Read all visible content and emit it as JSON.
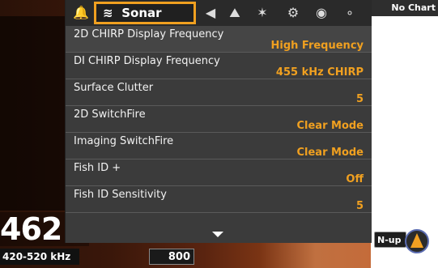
{
  "sonar": {
    "depth": "462",
    "frequency_label": "420-520 kHz",
    "scale_bottom": "800"
  },
  "chart": {
    "no_chart_label": "No Chart",
    "orientation_label": "N-up"
  },
  "menu": {
    "tabs": [
      {
        "icon": "alarm-icon",
        "glyph": "🔔"
      },
      {
        "icon": "sonar-icon",
        "glyph": "≋",
        "label": "Sonar",
        "active": true
      },
      {
        "icon": "navigation-icon",
        "glyph": "◀"
      },
      {
        "icon": "chart-icon",
        "glyph": "⛰"
      },
      {
        "icon": "radar-icon",
        "glyph": "✶"
      },
      {
        "icon": "settings-icon",
        "glyph": "⚙"
      },
      {
        "icon": "views-icon",
        "glyph": "◉"
      },
      {
        "icon": "accessories-icon",
        "glyph": "∘"
      }
    ],
    "items": [
      {
        "label": "2D CHIRP Display Frequency",
        "value": "High Frequency"
      },
      {
        "label": "DI CHIRP Display Frequency",
        "value": "455 kHz CHIRP"
      },
      {
        "label": "Surface Clutter",
        "value": "5"
      },
      {
        "label": "2D SwitchFire",
        "value": "Clear Mode"
      },
      {
        "label": "Imaging SwitchFire",
        "value": "Clear Mode"
      },
      {
        "label": "Fish ID +",
        "value": "Off"
      },
      {
        "label": "Fish ID Sensitivity",
        "value": "5"
      }
    ],
    "accent_color": "#f0a020"
  }
}
